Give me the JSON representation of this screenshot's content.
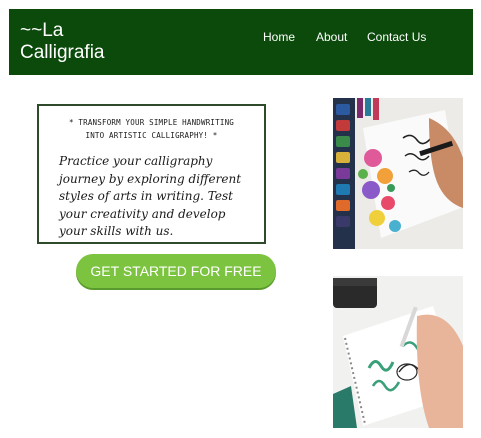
{
  "navbar": {
    "brand_line1": "~~La",
    "brand_line2": "Calligrafia",
    "links": [
      "Home",
      "About",
      "Contact Us"
    ],
    "background_color": "#0b4a0b"
  },
  "intro": {
    "tagline_line1": "* TRANSFORM YOUR SIMPLE HANDWRITING",
    "tagline_line2": "INTO ARTISTIC CALLIGRAPHY! *",
    "body": "Practice your calligraphy journey by exploring different styles of arts in writing. Test your creativity and develop your skills with us."
  },
  "cta": {
    "label": "GET STARTED FOR FREE",
    "color": "#7cc440"
  },
  "images": [
    {
      "name": "calligraphy-flowers-photo"
    },
    {
      "name": "calligraphy-notebook-photo"
    }
  ]
}
